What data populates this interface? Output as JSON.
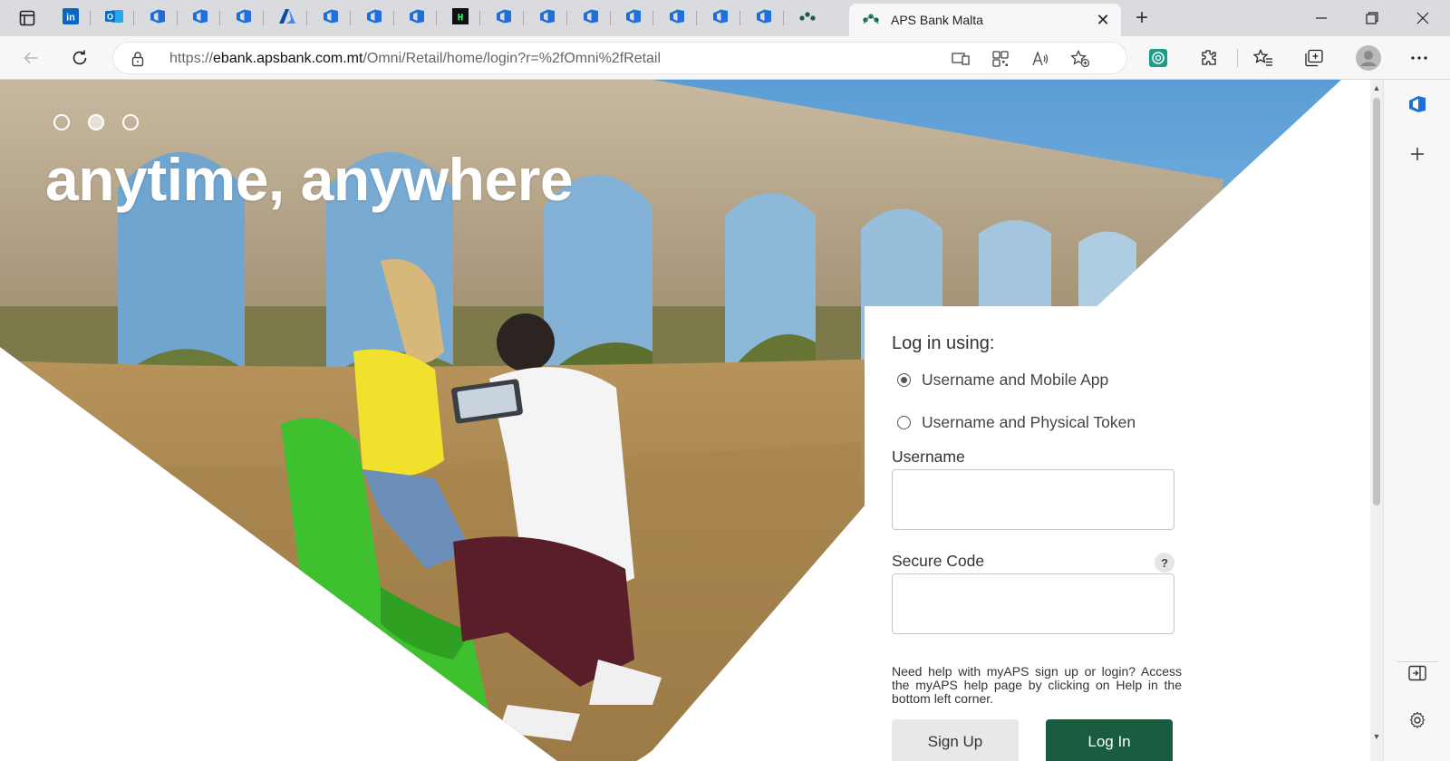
{
  "browser": {
    "pinned_tabs": [
      {
        "icon": "linkedin-icon",
        "label": "in",
        "color": "#0a66c2"
      },
      {
        "icon": "outlook-icon",
        "label": "O",
        "color": "#0f6cbd"
      },
      {
        "icon": "azure-devops-icon",
        "label": "",
        "color": "#1e6fd9"
      },
      {
        "icon": "azure-devops-icon",
        "label": "",
        "color": "#1e6fd9"
      },
      {
        "icon": "azure-devops-icon",
        "label": "",
        "color": "#1e6fd9"
      },
      {
        "icon": "azure-icon",
        "label": "A",
        "color": "#0a4aa8"
      },
      {
        "icon": "azure-devops-icon",
        "label": "",
        "color": "#1e6fd9"
      },
      {
        "icon": "azure-devops-icon",
        "label": "",
        "color": "#1e6fd9"
      },
      {
        "icon": "azure-devops-icon",
        "label": "",
        "color": "#1e6fd9"
      },
      {
        "icon": "hackernoon-icon",
        "label": "H",
        "color": "#111111"
      },
      {
        "icon": "azure-devops-icon",
        "label": "",
        "color": "#1e6fd9"
      },
      {
        "icon": "azure-devops-icon",
        "label": "",
        "color": "#1e6fd9"
      },
      {
        "icon": "azure-devops-icon",
        "label": "",
        "color": "#1e6fd9"
      },
      {
        "icon": "azure-devops-icon",
        "label": "",
        "color": "#1e6fd9"
      },
      {
        "icon": "azure-devops-icon",
        "label": "",
        "color": "#1e6fd9"
      },
      {
        "icon": "azure-devops-icon",
        "label": "",
        "color": "#1e6fd9"
      },
      {
        "icon": "azure-devops-icon",
        "label": "",
        "color": "#1e6fd9"
      },
      {
        "icon": "aps-bank-icon",
        "label": "",
        "color": "#1a5c3f"
      }
    ],
    "active_tab": {
      "title": "APS Bank Malta",
      "close": "✕"
    },
    "new_tab": "+",
    "url_prefix": "https://",
    "url_host": "ebank.apsbank.com.mt",
    "url_path": "/Omni/Retail/home/login?r=%2fOmni%2fRetail"
  },
  "hero": {
    "title": "anytime, anywhere",
    "carousel_active_index": 1
  },
  "login": {
    "heading": "Log in using:",
    "options": [
      {
        "label": "Username and Mobile App",
        "checked": true
      },
      {
        "label": "Username and Physical Token",
        "checked": false
      }
    ],
    "username_label": "Username",
    "username_value": "",
    "secure_code_label": "Secure Code",
    "secure_code_value": "",
    "help_badge": "?",
    "help_text": "Need help with myAPS sign up or login? Access the myAPS help page by clicking on Help in the bottom left corner.",
    "signup_button": "Sign Up",
    "login_button": "Log In"
  },
  "colors": {
    "brand_green": "#1a5c3f",
    "chair_green": "#3ec02f",
    "edge_blue": "#1e6fd9"
  }
}
